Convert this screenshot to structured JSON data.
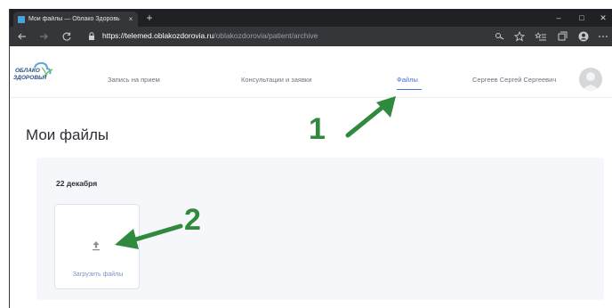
{
  "browser": {
    "tab_title": "Мои файлы — Облако Здоровь",
    "tab_close": "×",
    "new_tab": "+",
    "url_host": "https://telemed.oblakozdorovia.ru",
    "url_path": "/oblakozdorovia/patient/archive",
    "window_controls": [
      "–",
      "□",
      "✕"
    ]
  },
  "site": {
    "logo_line1": "ОБЛАКО",
    "logo_line2": "ЗДОРОВЬЯ",
    "nav": {
      "appointment": "Запись на прием",
      "consultations": "Консультации и заявки",
      "files": "Файлы"
    },
    "user_name": "Сергеев Сергей Сергеевич"
  },
  "main": {
    "page_title": "Мои файлы",
    "date_heading": "22 декабря",
    "upload_label": "Загрузить файлы"
  },
  "annotations": {
    "callout_1": "1",
    "callout_2": "2"
  },
  "colors": {
    "accent": "#4a6fd6",
    "annotation": "#2f8a3d",
    "card_bg": "#f5f7fa"
  }
}
